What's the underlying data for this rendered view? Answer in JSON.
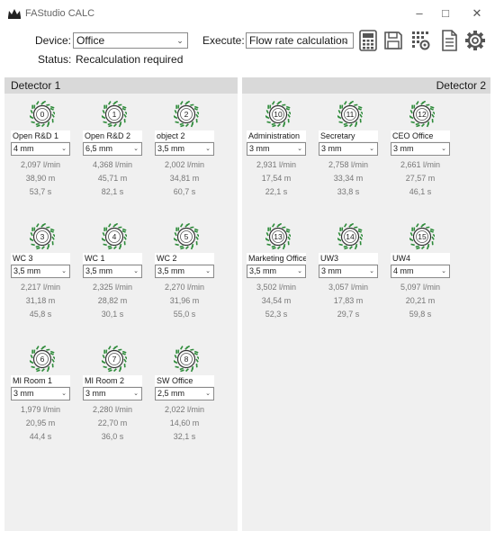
{
  "window": {
    "title": "FAStudio CALC",
    "min_glyph": "–",
    "max_glyph": "□",
    "close_glyph": "✕"
  },
  "toolbar": {
    "device_label": "Device:",
    "device_value": "Office",
    "execute_label": "Execute:",
    "execute_value": "Flow rate calculation",
    "status_label": "Status:",
    "status_value": "Recalculation required",
    "dropdown_glyph": "⌄",
    "icons": [
      "calculator-icon",
      "save-icon",
      "settings-grid-icon",
      "document-icon",
      "gear-icon"
    ]
  },
  "panels": [
    {
      "title": "Detector 1",
      "detectors": [
        {
          "number": "0",
          "name": "Open R&D 1",
          "pipe": "4 mm",
          "flow": "2,097 l/min",
          "length": "38,90 m",
          "time": "53,7 s"
        },
        {
          "number": "1",
          "name": "Open R&D 2",
          "pipe": "6,5 mm",
          "flow": "4,368 l/min",
          "length": "45,71 m",
          "time": "82,1 s"
        },
        {
          "number": "2",
          "name": "object 2",
          "pipe": "3,5 mm",
          "flow": "2,002 l/min",
          "length": "34,81 m",
          "time": "60,7 s"
        },
        {
          "number": "3",
          "name": "WC 3",
          "pipe": "3,5 mm",
          "flow": "2,217 l/min",
          "length": "31,18 m",
          "time": "45,8 s"
        },
        {
          "number": "4",
          "name": "WC 1",
          "pipe": "3,5 mm",
          "flow": "2,325 l/min",
          "length": "28,82 m",
          "time": "30,1 s"
        },
        {
          "number": "5",
          "name": "WC 2",
          "pipe": "3,5 mm",
          "flow": "2,270 l/min",
          "length": "31,96 m",
          "time": "55,0 s"
        },
        {
          "number": "6",
          "name": "MI Room 1",
          "pipe": "3 mm",
          "flow": "1,979 l/min",
          "length": "20,95 m",
          "time": "44,4 s"
        },
        {
          "number": "7",
          "name": "MI Room 2",
          "pipe": "3 mm",
          "flow": "2,280 l/min",
          "length": "22,70 m",
          "time": "36,0 s"
        },
        {
          "number": "8",
          "name": "SW Office",
          "pipe": "2,5 mm",
          "flow": "2,022 l/min",
          "length": "14,60 m",
          "time": "32,1 s"
        }
      ]
    },
    {
      "title": "Detector 2",
      "detectors": [
        {
          "number": "10",
          "name": "Administration",
          "pipe": "3 mm",
          "flow": "2,931 l/min",
          "length": "17,54 m",
          "time": "22,1 s"
        },
        {
          "number": "11",
          "name": "Secretary",
          "pipe": "3 mm",
          "flow": "2,758 l/min",
          "length": "33,34 m",
          "time": "33,8 s"
        },
        {
          "number": "12",
          "name": "CEO Office",
          "pipe": "3 mm",
          "flow": "2,661 l/min",
          "length": "27,57 m",
          "time": "46,1 s"
        },
        {
          "number": "13",
          "name": "Marketing Office",
          "pipe": "3,5 mm",
          "flow": "3,502 l/min",
          "length": "34,54 m",
          "time": "52,3 s"
        },
        {
          "number": "14",
          "name": "UW3",
          "pipe": "3 mm",
          "flow": "3,057 l/min",
          "length": "17,83 m",
          "time": "29,7 s"
        },
        {
          "number": "15",
          "name": "UW4",
          "pipe": "4 mm",
          "flow": "5,097 l/min",
          "length": "20,21 m",
          "time": "59,8 s"
        }
      ]
    }
  ],
  "colors": {
    "accent_green": "#2e8b3a",
    "panel_header": "#d9d9d9",
    "panel_body": "#f0f0f0"
  }
}
